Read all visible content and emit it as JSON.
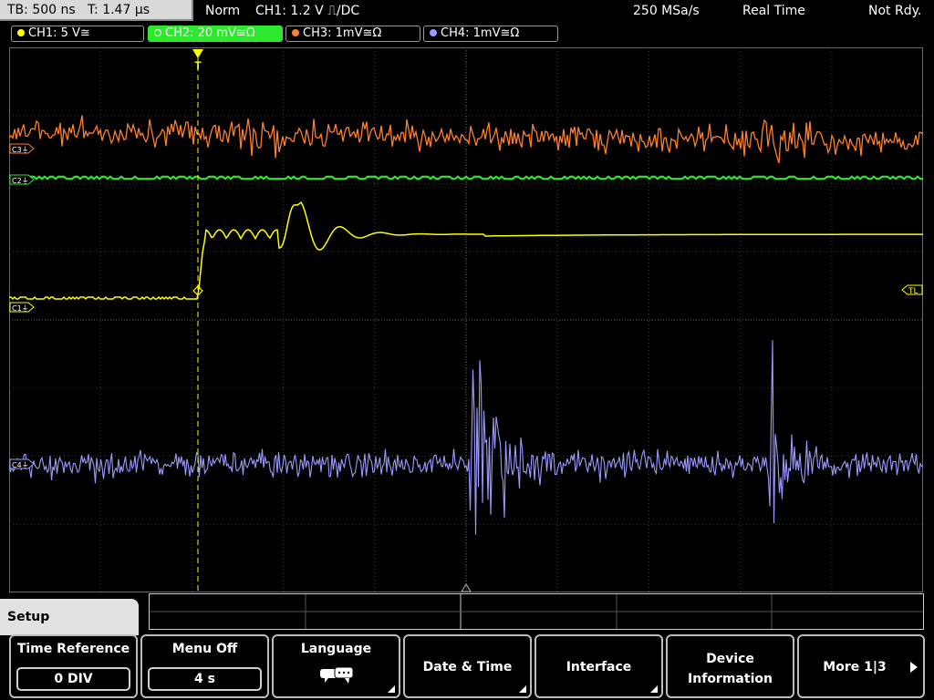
{
  "status_bar": {
    "timebase": "TB: 500 ns   T: 1.47 µs",
    "trigger_mode": "Norm",
    "trigger_source": "CH1: 1.2 V ⎍/DC",
    "sample_rate": "250 MSa/s",
    "acq_mode": "Real Time",
    "status": "Not Rdy."
  },
  "channel_tabs": [
    {
      "label": "CH1: 5 V≅",
      "color": "#ffff00"
    },
    {
      "label": "CH2: 20 mV≅Ω",
      "color": "#2ee82e"
    },
    {
      "label": "CH3: 1mV≅Ω",
      "color": "#ff7f2a"
    },
    {
      "label": "CH4: 1mV≅Ω",
      "color": "#9b9bff"
    }
  ],
  "markers": {
    "c3": "C3⏚",
    "c2": "C2⏚",
    "c1": "C1⏚",
    "c4": "C4⏚",
    "trigger_level": "TL",
    "trigger_pos": "T"
  },
  "menu": {
    "title": "Setup",
    "softkeys": {
      "time_reference": {
        "label": "Time Reference",
        "value": "0 DIV"
      },
      "menu_off": {
        "label": "Menu Off",
        "value": "4 s"
      },
      "language": {
        "label": "Language"
      },
      "date_time": {
        "label": "Date & Time"
      },
      "interface": {
        "label": "Interface"
      },
      "device_information": {
        "line1": "Device",
        "line2": "Information"
      },
      "more": {
        "label": "More 1|3"
      }
    }
  }
}
